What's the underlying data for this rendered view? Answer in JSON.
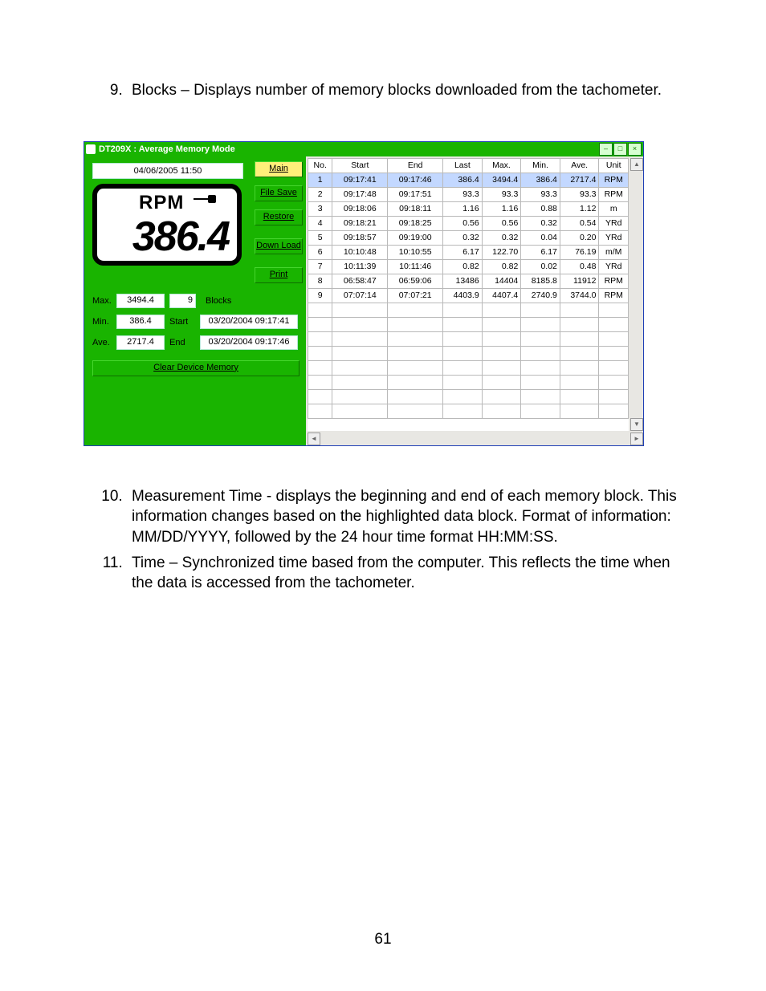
{
  "doc": {
    "item9_num": "9.",
    "item9_text": "Blocks – Displays number of memory blocks downloaded from the tachometer.",
    "item10_num": "10.",
    "item10_text": "Measurement Time - displays the beginning and end of each memory block.   This information changes based on the highlighted data block.   Format of information:  MM/DD/YYYY, followed by the 24 hour time format HH:MM:SS.",
    "item11_num": "11.",
    "item11_text": "Time – Synchronized time based from the computer.  This reflects the time when the data is accessed from the tachometer.",
    "page_number": "61"
  },
  "win": {
    "title": "DT209X : Average Memory Mode",
    "datetime": "04/06/2005 11:50",
    "buttons": {
      "main": "Main",
      "file_save": "File Save",
      "restore": "Restore",
      "download": "Down Load",
      "print": "Print"
    },
    "lcd": {
      "unit": "RPM",
      "value": "386.4"
    },
    "stats": {
      "max_label": "Max.",
      "max_val": "3494.4",
      "blocks_label": "Blocks",
      "blocks_val": "9",
      "min_label": "Min.",
      "min_val": "386.4",
      "start_label": "Start",
      "start_val": "03/20/2004 09:17:41",
      "ave_label": "Ave.",
      "ave_val": "2717.4",
      "end_label": "End",
      "end_val": "03/20/2004 09:17:46"
    },
    "clear_label": "Clear Device Memory",
    "columns": [
      "No.",
      "Start",
      "End",
      "Last",
      "Max.",
      "Min.",
      "Ave.",
      "Unit"
    ],
    "rows": [
      {
        "no": "1",
        "start": "09:17:41",
        "end": "09:17:46",
        "last": "386.4",
        "max": "3494.4",
        "min": "386.4",
        "ave": "2717.4",
        "unit": "RPM",
        "sel": true
      },
      {
        "no": "2",
        "start": "09:17:48",
        "end": "09:17:51",
        "last": "93.3",
        "max": "93.3",
        "min": "93.3",
        "ave": "93.3",
        "unit": "RPM"
      },
      {
        "no": "3",
        "start": "09:18:06",
        "end": "09:18:11",
        "last": "1.16",
        "max": "1.16",
        "min": "0.88",
        "ave": "1.12",
        "unit": "m"
      },
      {
        "no": "4",
        "start": "09:18:21",
        "end": "09:18:25",
        "last": "0.56",
        "max": "0.56",
        "min": "0.32",
        "ave": "0.54",
        "unit": "YRd"
      },
      {
        "no": "5",
        "start": "09:18:57",
        "end": "09:19:00",
        "last": "0.32",
        "max": "0.32",
        "min": "0.04",
        "ave": "0.20",
        "unit": "YRd"
      },
      {
        "no": "6",
        "start": "10:10:48",
        "end": "10:10:55",
        "last": "6.17",
        "max": "122.70",
        "min": "6.17",
        "ave": "76.19",
        "unit": "m/M"
      },
      {
        "no": "7",
        "start": "10:11:39",
        "end": "10:11:46",
        "last": "0.82",
        "max": "0.82",
        "min": "0.02",
        "ave": "0.48",
        "unit": "YRd"
      },
      {
        "no": "8",
        "start": "06:58:47",
        "end": "06:59:06",
        "last": "13486",
        "max": "14404",
        "min": "8185.8",
        "ave": "11912",
        "unit": "RPM"
      },
      {
        "no": "9",
        "start": "07:07:14",
        "end": "07:07:21",
        "last": "4403.9",
        "max": "4407.4",
        "min": "2740.9",
        "ave": "3744.0",
        "unit": "RPM"
      }
    ]
  }
}
